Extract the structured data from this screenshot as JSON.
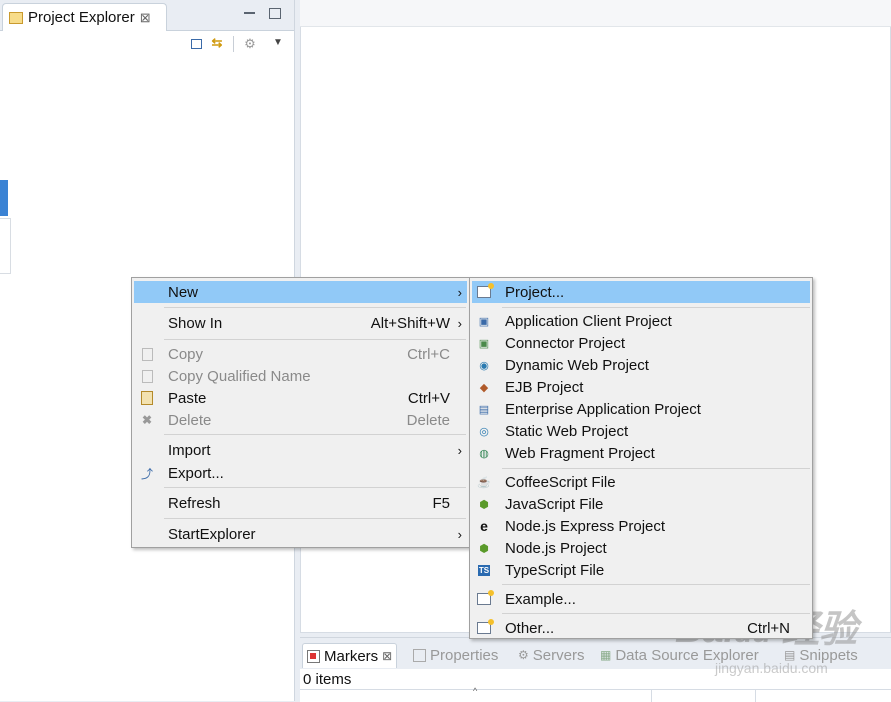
{
  "explorer": {
    "tab_label": "Project Explorer",
    "close_glyph": "⊠"
  },
  "bottom": {
    "tabs": [
      {
        "label": "Markers",
        "icon": "markers-icon",
        "active": true
      },
      {
        "label": "Properties",
        "icon": "properties-icon"
      },
      {
        "label": "Servers",
        "icon": "servers-icon"
      },
      {
        "label": "Data Source Explorer",
        "icon": "data-source-icon"
      },
      {
        "label": "Snippets",
        "icon": "snippets-icon"
      }
    ],
    "items_count": "0 items"
  },
  "context_menu": {
    "new": "New",
    "show_in": "Show In",
    "show_in_shortcut": "Alt+Shift+W",
    "copy": "Copy",
    "copy_shortcut": "Ctrl+C",
    "copy_qualified": "Copy Qualified Name",
    "paste": "Paste",
    "paste_shortcut": "Ctrl+V",
    "delete": "Delete",
    "delete_shortcut": "Delete",
    "import": "Import",
    "export": "Export...",
    "refresh": "Refresh",
    "refresh_shortcut": "F5",
    "startexplorer": "StartExplorer",
    "arrow": "›"
  },
  "submenu": {
    "project": "Project...",
    "app_client": "Application Client Project",
    "connector": "Connector Project",
    "dynamic_web": "Dynamic Web Project",
    "ejb": "EJB Project",
    "enterprise_app": "Enterprise Application Project",
    "static_web": "Static Web Project",
    "web_fragment": "Web Fragment Project",
    "coffeescript": "CoffeeScript File",
    "javascript": "JavaScript File",
    "node_express": "Node.js Express Project",
    "node_project": "Node.js Project",
    "typescript": "TypeScript File",
    "example": "Example...",
    "other": "Other...",
    "other_shortcut": "Ctrl+N"
  },
  "colors": {
    "highlight": "#91c9f7",
    "accent": "#3b83d4"
  }
}
